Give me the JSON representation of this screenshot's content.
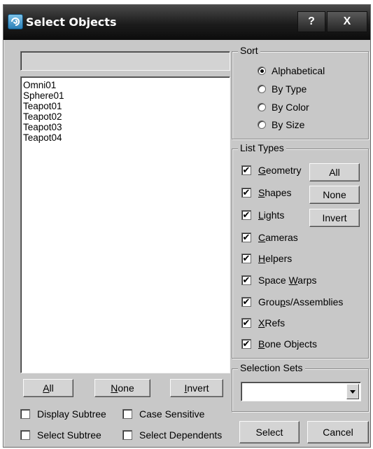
{
  "window": {
    "title": "Select Objects",
    "help_label": "?",
    "close_label": "X"
  },
  "search": {
    "value": "",
    "placeholder": ""
  },
  "objects": [
    "Omni01",
    "Sphere01",
    "Teapot01",
    "Teapot02",
    "Teapot03",
    "Teapot04"
  ],
  "list_buttons": {
    "all": {
      "u": "A",
      "rest": "ll"
    },
    "none": {
      "u": "N",
      "rest": "one"
    },
    "invert": {
      "u": "I",
      "rest": "nvert"
    }
  },
  "options": {
    "display_subtree": "Display Subtree",
    "case_sensitive": "Case Sensitive",
    "select_subtree": "Select Subtree",
    "select_dependents": "Select Dependents"
  },
  "sort": {
    "label": "Sort",
    "alphabetical": "Alphabetical",
    "by_type": "By Type",
    "by_color": "By Color",
    "by_size": "By Size",
    "selected": "Alphabetical"
  },
  "list_types": {
    "label": "List Types",
    "check_mark": "✔",
    "geometry": {
      "pre": "",
      "u": "G",
      "post": "eometry"
    },
    "shapes": {
      "pre": "",
      "u": "S",
      "post": "hapes"
    },
    "lights": {
      "pre": "",
      "u": "L",
      "post": "ights"
    },
    "cameras": {
      "pre": "",
      "u": "C",
      "post": "ameras"
    },
    "helpers": {
      "pre": "",
      "u": "H",
      "post": "elpers"
    },
    "space_warps": {
      "pre": "Space ",
      "u": "W",
      "post": "arps"
    },
    "groups": {
      "pre": "Grou",
      "u": "p",
      "post": "s/Assemblies"
    },
    "xrefs": {
      "pre": "",
      "u": "X",
      "post": "Refs"
    },
    "bone_objects": {
      "pre": "",
      "u": "B",
      "post": "one Objects"
    },
    "all_label": "All",
    "none_label": "None",
    "invert_label": "Invert"
  },
  "selection_sets": {
    "label": "Selection Sets",
    "value": ""
  },
  "actions": {
    "select": "Select",
    "cancel": "Cancel"
  }
}
